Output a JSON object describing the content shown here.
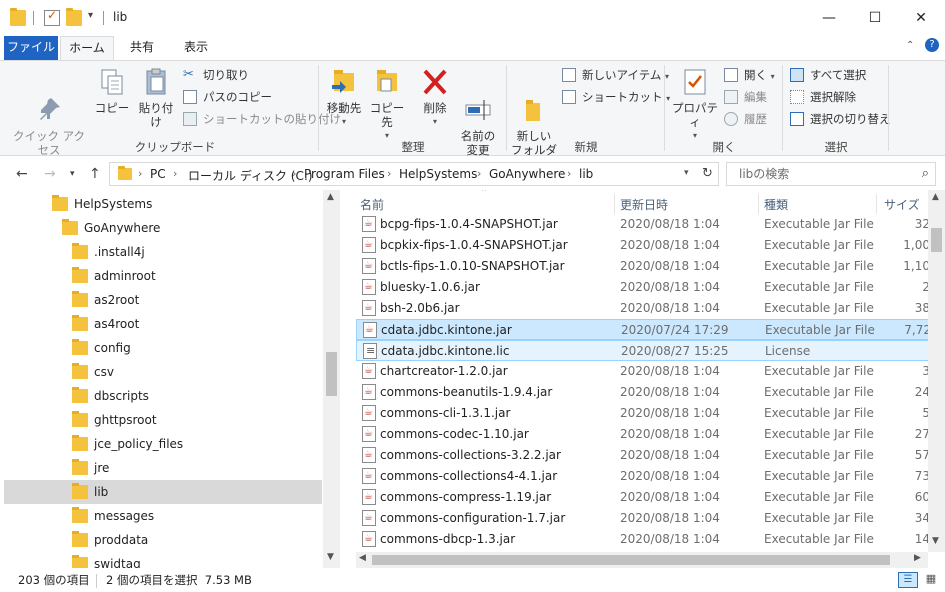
{
  "window": {
    "title": "lib",
    "minimize": "—",
    "maximize": "☐",
    "close": "✕"
  },
  "ribbon_tabs": {
    "file": "ファイル",
    "home": "ホーム",
    "share": "共有",
    "view": "表示"
  },
  "ribbon": {
    "clipboard": {
      "label": "クリップボード",
      "pin": "クイック アクセス\nにピン留めする",
      "copy": "コピー",
      "paste": "貼り付け",
      "cut": "切り取り",
      "copy_path": "パスのコピー",
      "paste_shortcut": "ショートカットの貼り付け"
    },
    "organize": {
      "label": "整理",
      "move_to": "移動先",
      "copy_to": "コピー先",
      "delete": "削除",
      "rename": "名前の\n変更"
    },
    "new": {
      "label": "新規",
      "new_folder": "新しい\nフォルダー",
      "new_item": "新しいアイテム",
      "shortcut": "ショートカット"
    },
    "open": {
      "label": "開く",
      "properties": "プロパティ",
      "open": "開く",
      "edit": "編集",
      "history": "履歴"
    },
    "select": {
      "label": "選択",
      "select_all": "すべて選択",
      "select_none": "選択解除",
      "invert": "選択の切り替え"
    }
  },
  "address": {
    "crumbs": [
      "PC",
      "ローカル ディスク (C:)",
      "Program Files",
      "HelpSystems",
      "GoAnywhere",
      "lib"
    ],
    "search_placeholder": "libの検索"
  },
  "tree": [
    {
      "label": "HelpSystems",
      "indent": 0
    },
    {
      "label": "GoAnywhere",
      "indent": 1
    },
    {
      "label": ".install4j",
      "indent": 2
    },
    {
      "label": "adminroot",
      "indent": 2
    },
    {
      "label": "as2root",
      "indent": 2
    },
    {
      "label": "as4root",
      "indent": 2
    },
    {
      "label": "config",
      "indent": 2
    },
    {
      "label": "csv",
      "indent": 2
    },
    {
      "label": "dbscripts",
      "indent": 2
    },
    {
      "label": "ghttpsroot",
      "indent": 2
    },
    {
      "label": "jce_policy_files",
      "indent": 2
    },
    {
      "label": "jre",
      "indent": 2
    },
    {
      "label": "lib",
      "indent": 2,
      "selected": true
    },
    {
      "label": "messages",
      "indent": 2
    },
    {
      "label": "proddata",
      "indent": 2
    },
    {
      "label": "swidtag",
      "indent": 2
    }
  ],
  "columns": {
    "name": "名前",
    "date": "更新日時",
    "type": "種類",
    "size": "サイズ"
  },
  "files": [
    {
      "name": "bcpg-fips-1.0.4-SNAPSHOT.jar",
      "date": "2020/08/18 1:04",
      "type": "Executable Jar File",
      "size": "32",
      "kind": "jar"
    },
    {
      "name": "bcpkix-fips-1.0.4-SNAPSHOT.jar",
      "date": "2020/08/18 1:04",
      "type": "Executable Jar File",
      "size": "1,00",
      "kind": "jar"
    },
    {
      "name": "bctls-fips-1.0.10-SNAPSHOT.jar",
      "date": "2020/08/18 1:04",
      "type": "Executable Jar File",
      "size": "1,10",
      "kind": "jar"
    },
    {
      "name": "bluesky-1.0.6.jar",
      "date": "2020/08/18 1:04",
      "type": "Executable Jar File",
      "size": "2",
      "kind": "jar"
    },
    {
      "name": "bsh-2.0b6.jar",
      "date": "2020/08/18 1:04",
      "type": "Executable Jar File",
      "size": "38",
      "kind": "jar"
    },
    {
      "name": "cdata.jdbc.kintone.jar",
      "date": "2020/07/24 17:29",
      "type": "Executable Jar File",
      "size": "7,72",
      "kind": "jar",
      "sel": 1
    },
    {
      "name": "cdata.jdbc.kintone.lic",
      "date": "2020/08/27 15:25",
      "type": "License",
      "size": "",
      "kind": "lic",
      "sel": 2
    },
    {
      "name": "chartcreator-1.2.0.jar",
      "date": "2020/08/18 1:04",
      "type": "Executable Jar File",
      "size": "3",
      "kind": "jar"
    },
    {
      "name": "commons-beanutils-1.9.4.jar",
      "date": "2020/08/18 1:04",
      "type": "Executable Jar File",
      "size": "24",
      "kind": "jar"
    },
    {
      "name": "commons-cli-1.3.1.jar",
      "date": "2020/08/18 1:04",
      "type": "Executable Jar File",
      "size": "5",
      "kind": "jar"
    },
    {
      "name": "commons-codec-1.10.jar",
      "date": "2020/08/18 1:04",
      "type": "Executable Jar File",
      "size": "27",
      "kind": "jar"
    },
    {
      "name": "commons-collections-3.2.2.jar",
      "date": "2020/08/18 1:04",
      "type": "Executable Jar File",
      "size": "57",
      "kind": "jar"
    },
    {
      "name": "commons-collections4-4.1.jar",
      "date": "2020/08/18 1:04",
      "type": "Executable Jar File",
      "size": "73",
      "kind": "jar"
    },
    {
      "name": "commons-compress-1.19.jar",
      "date": "2020/08/18 1:04",
      "type": "Executable Jar File",
      "size": "60",
      "kind": "jar"
    },
    {
      "name": "commons-configuration-1.7.jar",
      "date": "2020/08/18 1:04",
      "type": "Executable Jar File",
      "size": "34",
      "kind": "jar"
    },
    {
      "name": "commons-dbcp-1.3.jar",
      "date": "2020/08/18 1:04",
      "type": "Executable Jar File",
      "size": "14",
      "kind": "jar"
    }
  ],
  "status": {
    "count": "203 個の項目",
    "selected": "2 個の項目を選択  7.53 MB"
  }
}
